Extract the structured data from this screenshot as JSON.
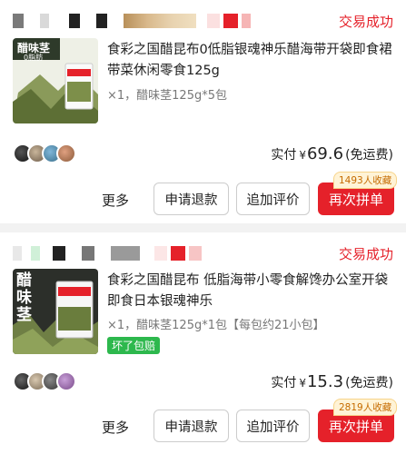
{
  "orders": [
    {
      "status": "交易成功",
      "title": "食彩之国醋昆布0低脂银魂神乐醋海带开袋即食裙带菜休闲零食125g",
      "spec": "×1，醋味茎125g*5包",
      "product_label": "醋味茎",
      "product_sub": "0脂肪",
      "paid_label": "实付",
      "currency": "¥",
      "paid_amount": "69.6",
      "shipping_note": "(免运费)",
      "more": "更多",
      "btn_refund": "申请退款",
      "btn_review": "追加评价",
      "btn_rebuy": "再次拼单",
      "fav_count": "1493人收藏"
    },
    {
      "status": "交易成功",
      "title": "食彩之国醋昆布 低脂海带小零食解馋办公室开袋即食日本银魂神乐",
      "spec": "×1，醋味茎125g*1包【每包约21小包】",
      "tag": "坏了包赔",
      "product_label": "醋味茎",
      "paid_label": "实付",
      "currency": "¥",
      "paid_amount": "15.3",
      "shipping_note": "(免运费)",
      "more": "更多",
      "btn_refund": "申请退款",
      "btn_review": "追加评价",
      "btn_rebuy": "再次拼单",
      "fav_count": "2819人收藏"
    }
  ],
  "colors": {
    "accent": "#e5212a",
    "tag_green": "#2db84d"
  }
}
